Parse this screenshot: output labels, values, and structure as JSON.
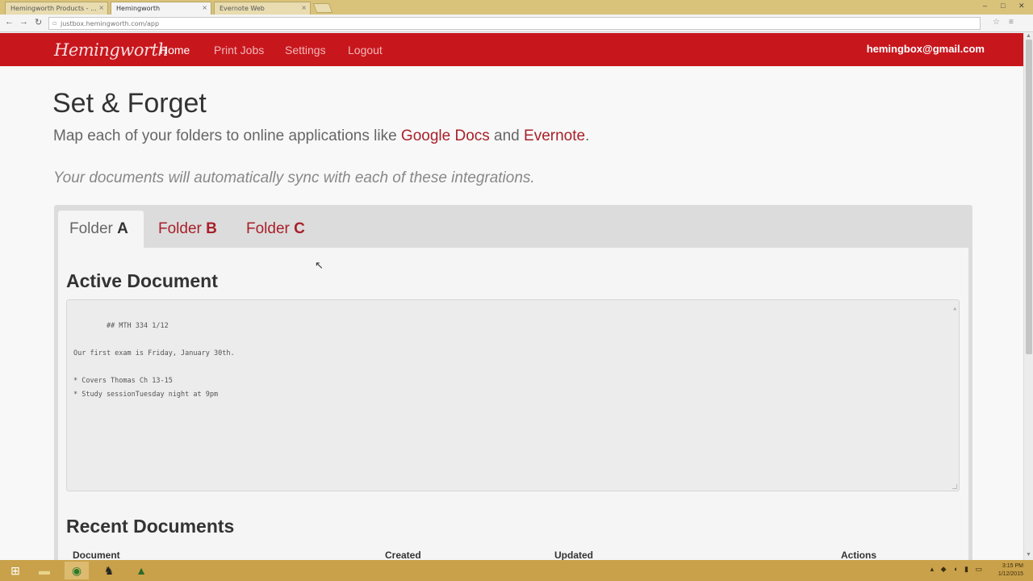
{
  "browser": {
    "tabs": [
      {
        "label": "Hemingworth Products - ...",
        "close": "×"
      },
      {
        "label": "Hemingworth",
        "close": "×"
      },
      {
        "label": "Evernote Web",
        "close": "×"
      }
    ],
    "url": "justbox.hemingworth.com/app",
    "window_controls": [
      "–",
      "□",
      "✕"
    ]
  },
  "navbar": {
    "brand": "Hemingworth",
    "links": [
      "Home",
      "Print Jobs",
      "Settings",
      "Logout"
    ],
    "user_email": "hemingbox@gmail.com"
  },
  "page": {
    "title": "Set & Forget",
    "lead_prefix": "Map each of your folders to online applications like ",
    "lead_link1": "Google Docs",
    "lead_mid": " and ",
    "lead_link2": "Evernote",
    "lead_suffix": ".",
    "note": "Your documents will automatically sync with each of these integrations."
  },
  "folder_tabs": [
    {
      "prefix": "Folder ",
      "letter": "A"
    },
    {
      "prefix": "Folder ",
      "letter": "B"
    },
    {
      "prefix": "Folder ",
      "letter": "C"
    }
  ],
  "active_document": {
    "heading": "Active Document",
    "content": "## MTH 334 1/12\n\nOur first exam is Friday, January 30th.\n\n* Covers Thomas Ch 13-15\n* Study sessionTuesday night at 9pm"
  },
  "recent_documents": {
    "heading": "Recent Documents",
    "columns": [
      "Document",
      "Created",
      "Updated",
      "Actions"
    ]
  },
  "taskbar": {
    "clock_time": "3:15 PM",
    "clock_date": "1/12/2015"
  },
  "colors": {
    "brand_red": "#c8161d",
    "accent_link": "#a8202a",
    "taskbar": "#c9a14a"
  }
}
